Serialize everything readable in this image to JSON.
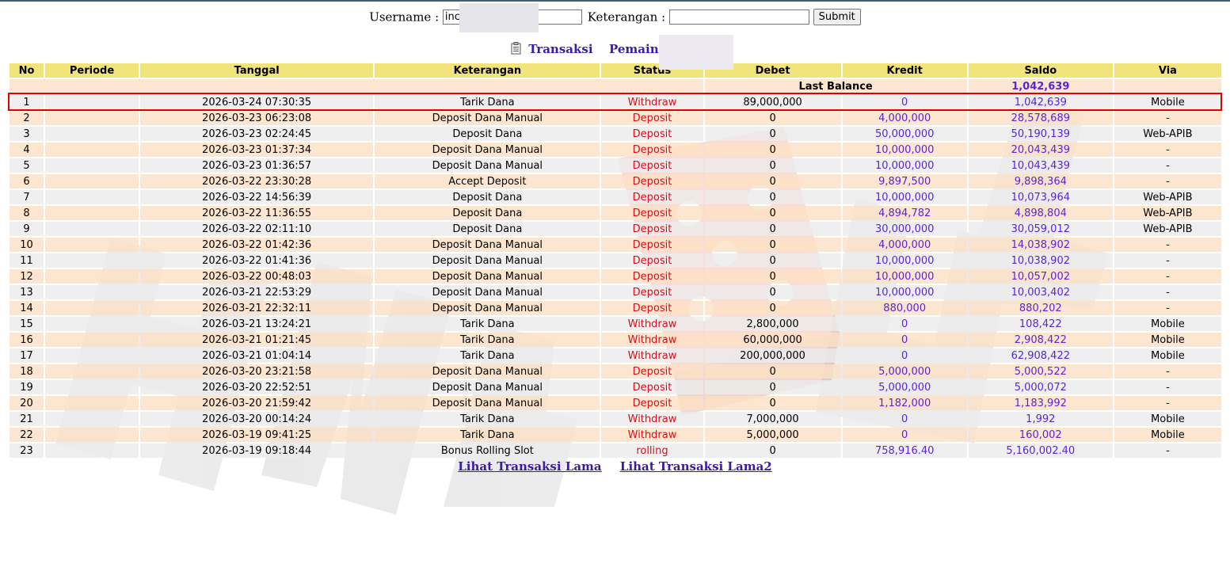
{
  "search": {
    "username_label": "Username :",
    "username_value": "inc",
    "keterangan_label": "Keterangan :",
    "keterangan_value": "",
    "submit_label": "Submit"
  },
  "heading": {
    "transaksi_label": "Transaksi",
    "pemain_label": "Pemain : inc"
  },
  "table": {
    "headers": [
      "No",
      "Periode",
      "Tanggal",
      "Keterangan",
      "Status",
      "Debet",
      "Kredit",
      "Saldo",
      "Via"
    ],
    "last_balance_label": "Last Balance",
    "last_balance_value": "1,042,639",
    "rows": [
      {
        "no": "1",
        "periode": "",
        "tanggal": "2026-03-24 07:30:35",
        "keterangan": "Tarik Dana",
        "status": "Withdraw",
        "debet": "89,000,000",
        "kredit": "0",
        "saldo": "1,042,639",
        "via": "Mobile"
      },
      {
        "no": "2",
        "periode": "",
        "tanggal": "2026-03-23 06:23:08",
        "keterangan": "Deposit Dana Manual",
        "status": "Deposit",
        "debet": "0",
        "kredit": "4,000,000",
        "saldo": "28,578,689",
        "via": "-"
      },
      {
        "no": "3",
        "periode": "",
        "tanggal": "2026-03-23 02:24:45",
        "keterangan": "Deposit Dana",
        "status": "Deposit",
        "debet": "0",
        "kredit": "50,000,000",
        "saldo": "50,190,139",
        "via": "Web-APIB"
      },
      {
        "no": "4",
        "periode": "",
        "tanggal": "2026-03-23 01:37:34",
        "keterangan": "Deposit Dana Manual",
        "status": "Deposit",
        "debet": "0",
        "kredit": "10,000,000",
        "saldo": "20,043,439",
        "via": "-"
      },
      {
        "no": "5",
        "periode": "",
        "tanggal": "2026-03-23 01:36:57",
        "keterangan": "Deposit Dana Manual",
        "status": "Deposit",
        "debet": "0",
        "kredit": "10,000,000",
        "saldo": "10,043,439",
        "via": "-"
      },
      {
        "no": "6",
        "periode": "",
        "tanggal": "2026-03-22 23:30:28",
        "keterangan": "Accept Deposit",
        "status": "Deposit",
        "debet": "0",
        "kredit": "9,897,500",
        "saldo": "9,898,364",
        "via": "-"
      },
      {
        "no": "7",
        "periode": "",
        "tanggal": "2026-03-22 14:56:39",
        "keterangan": "Deposit Dana",
        "status": "Deposit",
        "debet": "0",
        "kredit": "10,000,000",
        "saldo": "10,073,964",
        "via": "Web-APIB"
      },
      {
        "no": "8",
        "periode": "",
        "tanggal": "2026-03-22 11:36:55",
        "keterangan": "Deposit Dana",
        "status": "Deposit",
        "debet": "0",
        "kredit": "4,894,782",
        "saldo": "4,898,804",
        "via": "Web-APIB"
      },
      {
        "no": "9",
        "periode": "",
        "tanggal": "2026-03-22 02:11:10",
        "keterangan": "Deposit Dana",
        "status": "Deposit",
        "debet": "0",
        "kredit": "30,000,000",
        "saldo": "30,059,012",
        "via": "Web-APIB"
      },
      {
        "no": "10",
        "periode": "",
        "tanggal": "2026-03-22 01:42:36",
        "keterangan": "Deposit Dana Manual",
        "status": "Deposit",
        "debet": "0",
        "kredit": "4,000,000",
        "saldo": "14,038,902",
        "via": "-"
      },
      {
        "no": "11",
        "periode": "",
        "tanggal": "2026-03-22 01:41:36",
        "keterangan": "Deposit Dana Manual",
        "status": "Deposit",
        "debet": "0",
        "kredit": "10,000,000",
        "saldo": "10,038,902",
        "via": "-"
      },
      {
        "no": "12",
        "periode": "",
        "tanggal": "2026-03-22 00:48:03",
        "keterangan": "Deposit Dana Manual",
        "status": "Deposit",
        "debet": "0",
        "kredit": "10,000,000",
        "saldo": "10,057,002",
        "via": "-"
      },
      {
        "no": "13",
        "periode": "",
        "tanggal": "2026-03-21 22:53:29",
        "keterangan": "Deposit Dana Manual",
        "status": "Deposit",
        "debet": "0",
        "kredit": "10,000,000",
        "saldo": "10,003,402",
        "via": "-"
      },
      {
        "no": "14",
        "periode": "",
        "tanggal": "2026-03-21 22:32:11",
        "keterangan": "Deposit Dana Manual",
        "status": "Deposit",
        "debet": "0",
        "kredit": "880,000",
        "saldo": "880,202",
        "via": "-"
      },
      {
        "no": "15",
        "periode": "",
        "tanggal": "2026-03-21 13:24:21",
        "keterangan": "Tarik Dana",
        "status": "Withdraw",
        "debet": "2,800,000",
        "kredit": "0",
        "saldo": "108,422",
        "via": "Mobile"
      },
      {
        "no": "16",
        "periode": "",
        "tanggal": "2026-03-21 01:21:45",
        "keterangan": "Tarik Dana",
        "status": "Withdraw",
        "debet": "60,000,000",
        "kredit": "0",
        "saldo": "2,908,422",
        "via": "Mobile"
      },
      {
        "no": "17",
        "periode": "",
        "tanggal": "2026-03-21 01:04:14",
        "keterangan": "Tarik Dana",
        "status": "Withdraw",
        "debet": "200,000,000",
        "kredit": "0",
        "saldo": "62,908,422",
        "via": "Mobile"
      },
      {
        "no": "18",
        "periode": "",
        "tanggal": "2026-03-20 23:21:58",
        "keterangan": "Deposit Dana Manual",
        "status": "Deposit",
        "debet": "0",
        "kredit": "5,000,000",
        "saldo": "5,000,522",
        "via": "-"
      },
      {
        "no": "19",
        "periode": "",
        "tanggal": "2026-03-20 22:52:51",
        "keterangan": "Deposit Dana Manual",
        "status": "Deposit",
        "debet": "0",
        "kredit": "5,000,000",
        "saldo": "5,000,072",
        "via": "-"
      },
      {
        "no": "20",
        "periode": "",
        "tanggal": "2026-03-20 21:59:42",
        "keterangan": "Deposit Dana Manual",
        "status": "Deposit",
        "debet": "0",
        "kredit": "1,182,000",
        "saldo": "1,183,992",
        "via": "-"
      },
      {
        "no": "21",
        "periode": "",
        "tanggal": "2026-03-20 00:14:24",
        "keterangan": "Tarik Dana",
        "status": "Withdraw",
        "debet": "7,000,000",
        "kredit": "0",
        "saldo": "1,992",
        "via": "Mobile"
      },
      {
        "no": "22",
        "periode": "",
        "tanggal": "2026-03-19 09:41:25",
        "keterangan": "Tarik Dana",
        "status": "Withdraw",
        "debet": "5,000,000",
        "kredit": "0",
        "saldo": "160,002",
        "via": "Mobile"
      },
      {
        "no": "23",
        "periode": "",
        "tanggal": "2026-03-19 09:18:44",
        "keterangan": "Bonus Rolling Slot",
        "status": "rolling",
        "debet": "0",
        "kredit": "758,916.40",
        "saldo": "5,160,002.40",
        "via": "-"
      }
    ]
  },
  "links": {
    "old_label": "Lihat Transaksi Lama",
    "old2_label": "Lihat Transaksi Lama2"
  },
  "colors": {
    "header_bg": "#f1e47a",
    "row_peach": "#fce0c4",
    "row_gray": "#ececec",
    "status_red": "#d4101c",
    "amount_purple": "#5a24d6",
    "link_purple": "#3a1aa6",
    "highlight_red": "#e00000"
  },
  "icons": {
    "heading_icon": "document-icon"
  }
}
